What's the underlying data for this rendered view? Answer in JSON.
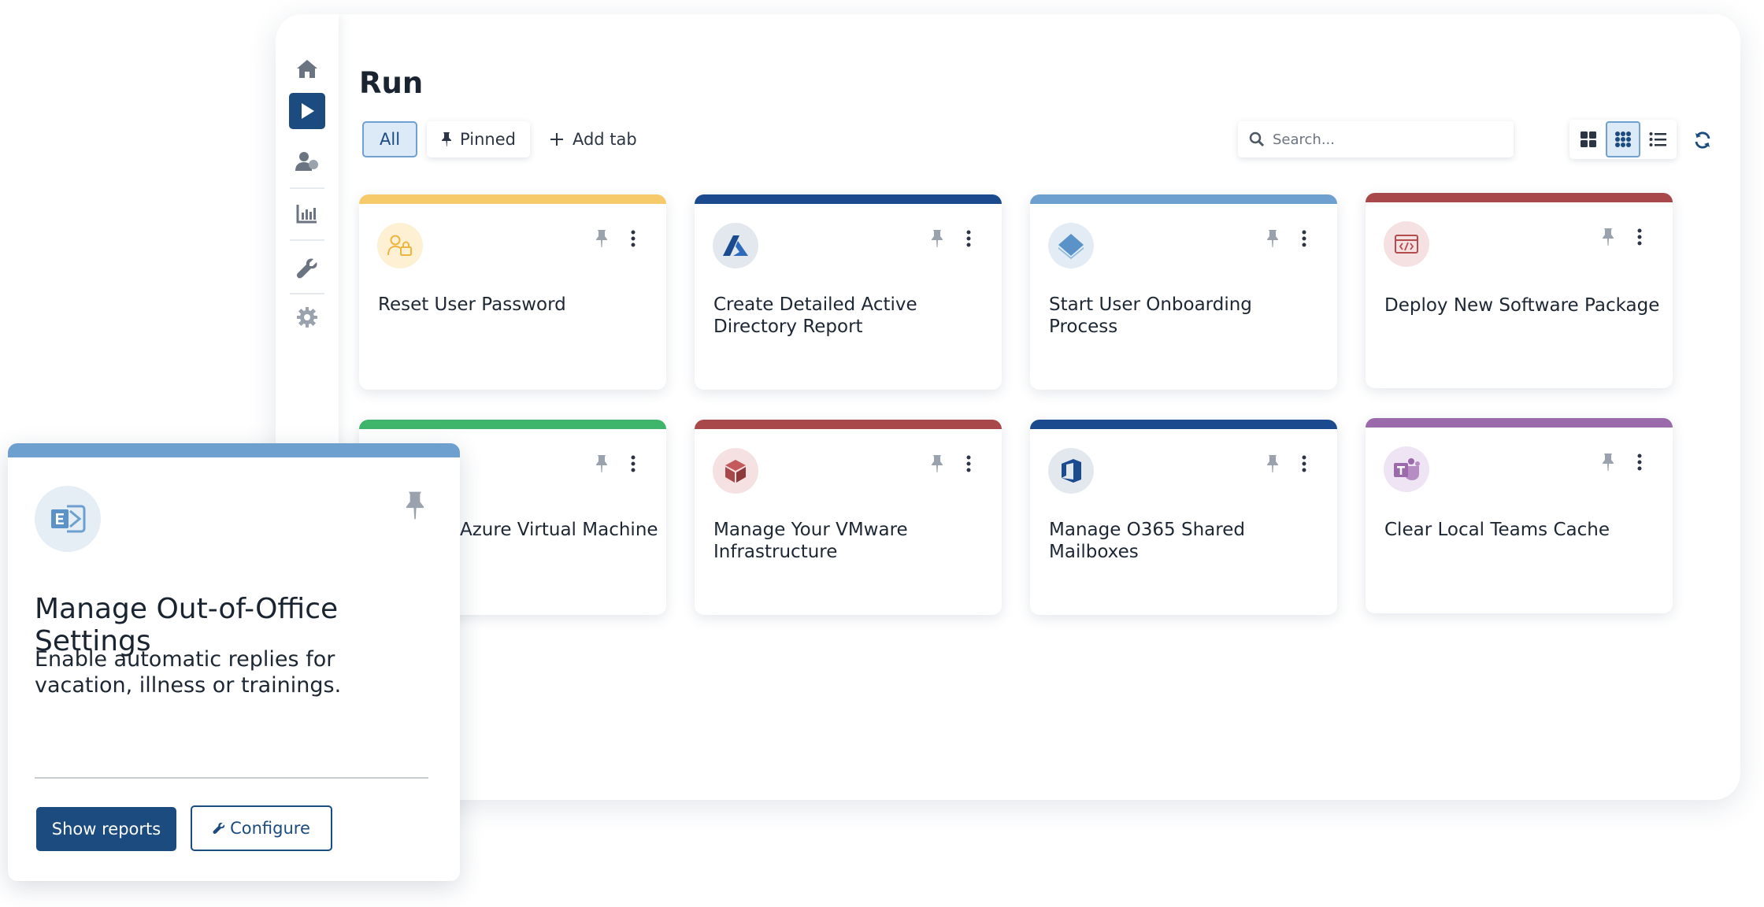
{
  "page": {
    "title": "Run"
  },
  "tabs": {
    "all": "All",
    "pinned": "Pinned",
    "add": "Add tab"
  },
  "search": {
    "placeholder": "Search..."
  },
  "sidebar": {
    "items": [
      {
        "icon": "home-icon"
      },
      {
        "icon": "play-icon",
        "active": true
      },
      {
        "icon": "users-icon"
      },
      {
        "icon": "chart-icon"
      },
      {
        "icon": "wrench-icon"
      },
      {
        "icon": "gear-icon"
      }
    ]
  },
  "cards": [
    {
      "name": "Reset User Password",
      "color": "#f6c96b",
      "icon": "user-lock-icon"
    },
    {
      "name": "Create Detailed Active Directory Report",
      "color": "#1b4a8f",
      "icon": "azure-icon"
    },
    {
      "name": "Start User Onboarding Process",
      "color": "#6ea0cf",
      "icon": "layers-icon"
    },
    {
      "name": "Deploy New Software Package",
      "color": "#a8484a",
      "icon": "code-window-icon"
    },
    {
      "name": "Azure Virtual Machine",
      "color": "#3fb56b",
      "icon": "vm-icon"
    },
    {
      "name": "Manage Your VMware Infrastructure",
      "color": "#a8484a",
      "icon": "cube-icon"
    },
    {
      "name": "Manage O365 Shared Mailboxes",
      "color": "#1b4a8f",
      "icon": "office-icon"
    },
    {
      "name": "Clear Local Teams Cache",
      "color": "#9b6aab",
      "icon": "teams-icon"
    }
  ],
  "popup": {
    "title": "Manage Out-of-Office Settings",
    "description": "Enable automatic replies for vacation, illness or trainings.",
    "show_reports": "Show reports",
    "configure": "Configure",
    "icon": "exchange-icon"
  }
}
